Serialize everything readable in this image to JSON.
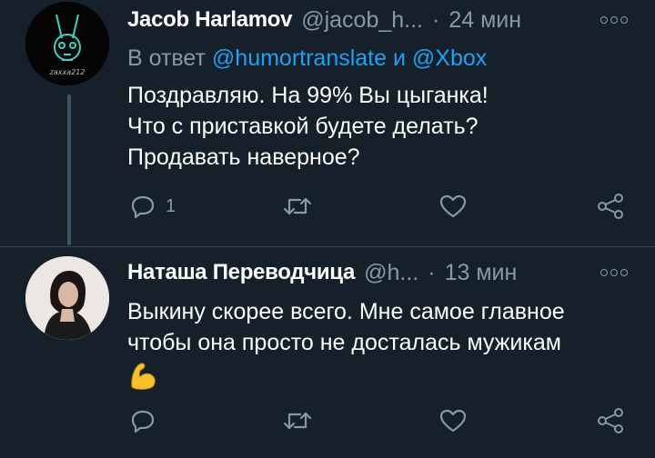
{
  "tweets": [
    {
      "avatar_icon": "rabbit-skull-avatar",
      "avatar_caption": "zaxxa212",
      "name": "Jacob Harlamov",
      "handle": "@jacob_h...",
      "separator": "·",
      "time": "24 мин",
      "reply_prefix": "В ответ",
      "reply_mention_1": "@humortranslate",
      "reply_and": "и",
      "reply_mention_2": "@Xbox",
      "text": "Поздравляю. На 99% Вы цыганка!\nЧто с приставкой будете делать?\nПродавать наверное?",
      "reply_count": "1",
      "icons": [
        "reply-icon",
        "retweet-icon",
        "like-icon",
        "share-icon"
      ]
    },
    {
      "avatar_icon": "woman-portrait-avatar",
      "name": "Наташа Переводчица",
      "handle": "@h...",
      "separator": "·",
      "time": "13 мин",
      "text": "Выкину скорее всего. Мне самое главное\nчтобы она просто не досталась мужикам",
      "emoji_icon": "flexed-biceps-icon",
      "reply_count": "",
      "icons": [
        "reply-icon",
        "retweet-icon",
        "like-icon",
        "share-icon"
      ]
    }
  ],
  "colors": {
    "background": "#15202b",
    "text": "#ffffff",
    "secondary": "#8899a6",
    "mention": "#1da1f2",
    "divider": "#38444d"
  }
}
